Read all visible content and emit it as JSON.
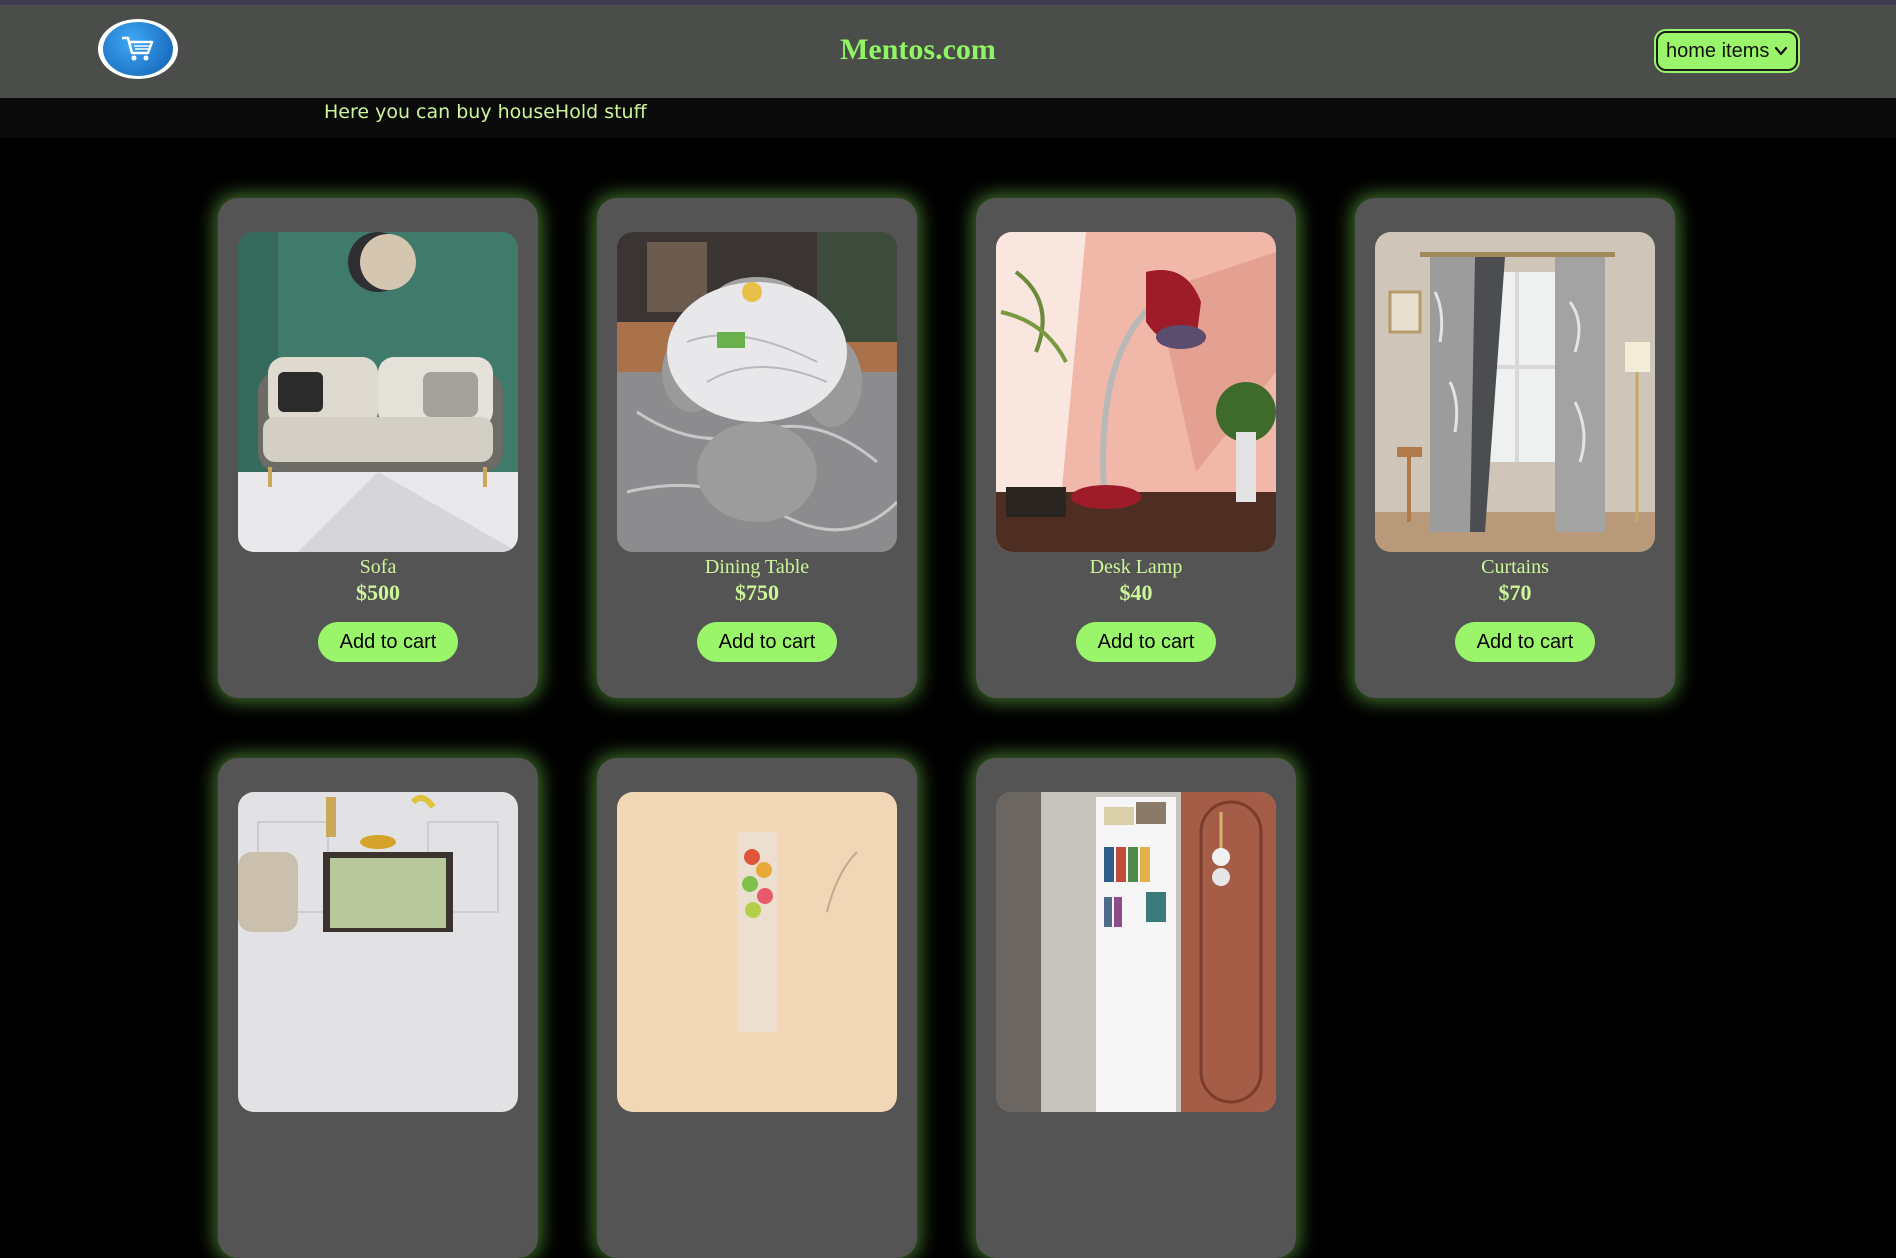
{
  "header": {
    "logo_icon": "shopping-cart-icon",
    "title": "Mentos.com",
    "category_select": {
      "selected": "home items",
      "icon": "chevron-down-icon"
    }
  },
  "tagline": "Here you can buy houseHold stuff",
  "colors": {
    "accent": "#9bf56b",
    "title": "#8ff562",
    "header_bg": "#4a4d49",
    "card_bg": "#545454",
    "page_bg": "#000000"
  },
  "products": [
    {
      "name": "Sofa",
      "price": "$500",
      "button": "Add to cart"
    },
    {
      "name": "Dining Table",
      "price": "$750",
      "button": "Add to cart"
    },
    {
      "name": "Desk Lamp",
      "price": "$40",
      "button": "Add to cart"
    },
    {
      "name": "Curtains",
      "price": "$70",
      "button": "Add to cart"
    }
  ],
  "partial_products": [
    {
      "image": "sideboard-photo"
    },
    {
      "image": "vase-photo"
    },
    {
      "image": "bookshelf-photo"
    }
  ]
}
